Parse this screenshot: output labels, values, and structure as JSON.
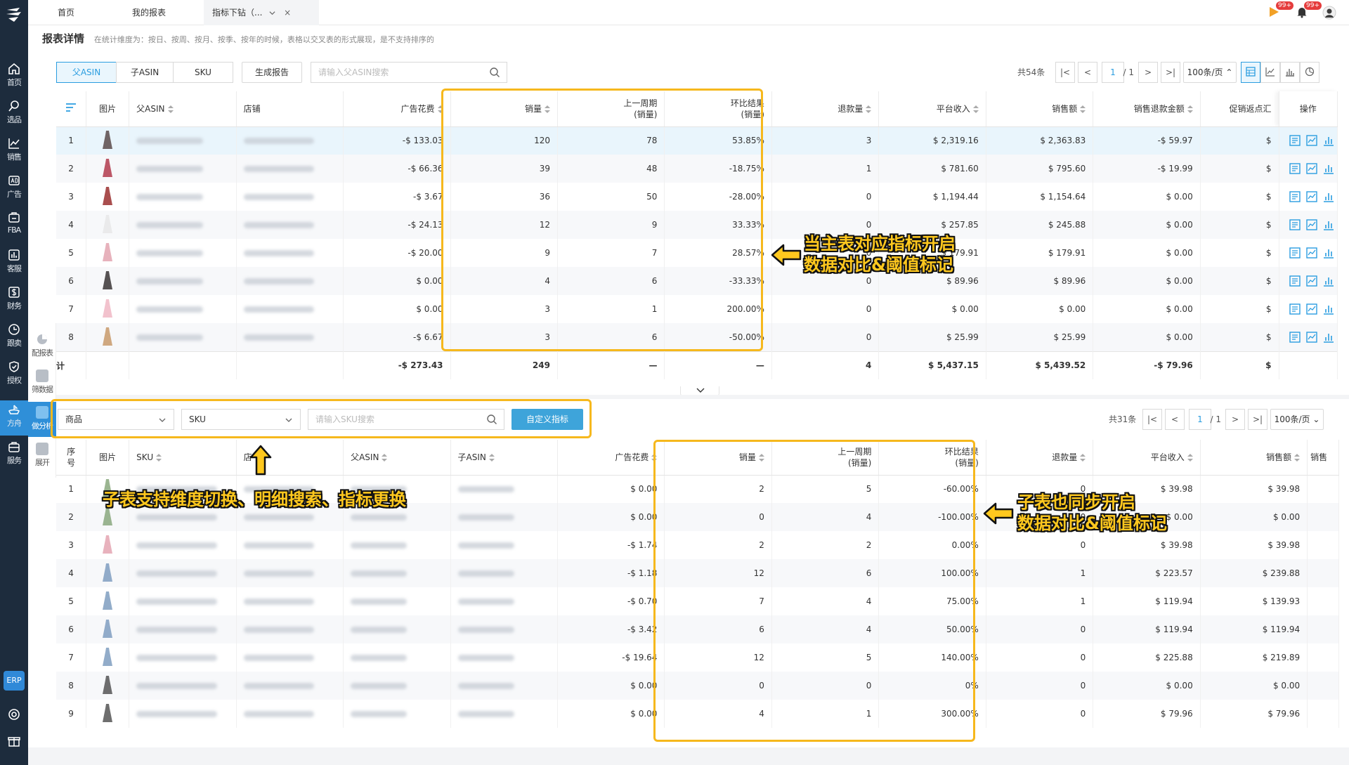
{
  "sidebar": {
    "items": [
      {
        "label": "首页",
        "icon": "home-icon"
      },
      {
        "label": "选品",
        "icon": "search-icon"
      },
      {
        "label": "销售",
        "icon": "trend-icon"
      },
      {
        "label": "广告",
        "icon": "ad-icon"
      },
      {
        "label": "FBA",
        "icon": "box-icon"
      },
      {
        "label": "客服",
        "icon": "chart-box-icon"
      },
      {
        "label": "财务",
        "icon": "dollar-icon"
      },
      {
        "label": "跟卖",
        "icon": "clock-icon"
      },
      {
        "label": "授权",
        "icon": "shield-icon"
      },
      {
        "label": "方舟",
        "icon": "ark-icon"
      },
      {
        "label": "服务",
        "icon": "briefcase-icon"
      }
    ],
    "erp": "ERP",
    "subnav": [
      {
        "label": "配报表"
      },
      {
        "label": "筛数据"
      },
      {
        "label": "做分析"
      },
      {
        "label": "展开"
      }
    ]
  },
  "tabs": [
    {
      "label": "首页"
    },
    {
      "label": "我的报表"
    },
    {
      "label": "指标下钻（...",
      "close": "×"
    }
  ],
  "badges": [
    "99+",
    "99+"
  ],
  "page": {
    "title": "报表详情",
    "desc": "在统计维度为：按日、按周、按月、按季、按年的时候，表格以交叉表的形式展现，是不支持排序的"
  },
  "main": {
    "segments": [
      "父ASIN",
      "子ASIN",
      "SKU"
    ],
    "report_button": "生成报告",
    "search_placeholder": "请输入父ASIN搜索",
    "pager": {
      "total": "共54条",
      "page": "1",
      "pages": "/ 1",
      "size": "100条/页"
    },
    "columns": [
      "图片",
      "父ASIN",
      "店铺",
      "广告花费",
      "销量",
      "上一周期",
      "(销量)",
      "环比结果",
      "(销量)",
      "退款量",
      "平台收入",
      "销售额",
      "销售退款金额",
      "促销返点汇",
      "操作"
    ],
    "rows": [
      {
        "no": "1",
        "ad": "-$ 133.03",
        "sales": "120",
        "prev": "78",
        "ratio": "53.85%",
        "refund": "3",
        "income": "$ 2,319.16",
        "amount": "$ 2,363.83",
        "refund_amt": "-$ 59.97",
        "promo": "$"
      },
      {
        "no": "2",
        "ad": "-$ 66.36",
        "sales": "39",
        "prev": "48",
        "ratio": "-18.75%",
        "refund": "1",
        "income": "$ 781.60",
        "amount": "$ 795.60",
        "refund_amt": "-$ 19.99",
        "promo": "$"
      },
      {
        "no": "3",
        "ad": "-$ 3.67",
        "sales": "36",
        "prev": "50",
        "ratio": "-28.00%",
        "refund": "0",
        "income": "$ 1,194.44",
        "amount": "$ 1,154.64",
        "refund_amt": "$ 0.00",
        "promo": "$"
      },
      {
        "no": "4",
        "ad": "-$ 24.13",
        "sales": "12",
        "prev": "9",
        "ratio": "33.33%",
        "refund": "0",
        "income": "$ 257.85",
        "amount": "$ 245.88",
        "refund_amt": "$ 0.00",
        "promo": "$"
      },
      {
        "no": "5",
        "ad": "-$ 20.00",
        "sales": "9",
        "prev": "7",
        "ratio": "28.57%",
        "refund": "0",
        "income": "$ 179.91",
        "amount": "$ 179.91",
        "refund_amt": "$ 0.00",
        "promo": "$"
      },
      {
        "no": "6",
        "ad": "$ 0.00",
        "sales": "4",
        "prev": "6",
        "ratio": "-33.33%",
        "refund": "0",
        "income": "$ 89.96",
        "amount": "$ 89.96",
        "refund_amt": "$ 0.00",
        "promo": "$"
      },
      {
        "no": "7",
        "ad": "$ 0.00",
        "sales": "3",
        "prev": "1",
        "ratio": "200.00%",
        "refund": "0",
        "income": "$ 0.00",
        "amount": "$ 0.00",
        "refund_amt": "$ 0.00",
        "promo": "$"
      },
      {
        "no": "8",
        "ad": "-$ 6.67",
        "sales": "3",
        "prev": "6",
        "ratio": "-50.00%",
        "refund": "0",
        "income": "$ 25.99",
        "amount": "$ 25.99",
        "refund_amt": "$ 0.00",
        "promo": "$"
      }
    ],
    "summary": {
      "label": "计",
      "ad": "-$ 273.43",
      "sales": "249",
      "prev": "—",
      "ratio": "—",
      "refund": "4",
      "income": "$ 5,437.15",
      "amount": "$ 5,439.52",
      "refund_amt": "-$ 79.96",
      "promo": "$"
    }
  },
  "sub": {
    "dim_select": "商品",
    "sub_select": "SKU",
    "search_placeholder": "请输入SKU搜索",
    "custom_button": "自定义指标",
    "pager": {
      "total": "共31条",
      "page": "1",
      "pages": "/ 1",
      "size": "100条/页"
    },
    "columns": [
      "序号",
      "图片",
      "SKU",
      "店",
      "父ASIN",
      "子ASIN",
      "广告花费",
      "销量",
      "上一周期",
      "(销量)",
      "环比结果",
      "(销量)",
      "退款量",
      "平台收入",
      "销售额",
      "销售"
    ],
    "rows": [
      {
        "no": "1",
        "ad": "$ 0.00",
        "sales": "2",
        "prev": "5",
        "ratio": "-60.00%",
        "refund": "0",
        "income": "$ 39.98",
        "amount": "$ 39.98"
      },
      {
        "no": "2",
        "ad": "$ 0.00",
        "sales": "0",
        "prev": "4",
        "ratio": "-100.00%",
        "refund": "0",
        "income": "$ 0.00",
        "amount": "$ 0.00"
      },
      {
        "no": "3",
        "ad": "-$ 1.74",
        "sales": "2",
        "prev": "2",
        "ratio": "0.00%",
        "refund": "0",
        "income": "$ 39.98",
        "amount": "$ 39.98"
      },
      {
        "no": "4",
        "ad": "-$ 1.18",
        "sales": "12",
        "prev": "6",
        "ratio": "100.00%",
        "refund": "1",
        "income": "$ 223.57",
        "amount": "$ 239.88"
      },
      {
        "no": "5",
        "ad": "-$ 0.70",
        "sales": "7",
        "prev": "4",
        "ratio": "75.00%",
        "refund": "1",
        "income": "$ 119.94",
        "amount": "$ 139.93"
      },
      {
        "no": "6",
        "ad": "-$ 3.42",
        "sales": "6",
        "prev": "4",
        "ratio": "50.00%",
        "refund": "0",
        "income": "$ 119.94",
        "amount": "$ 119.94"
      },
      {
        "no": "7",
        "ad": "-$ 19.64",
        "sales": "12",
        "prev": "5",
        "ratio": "140.00%",
        "refund": "0",
        "income": "$ 225.88",
        "amount": "$ 219.89"
      },
      {
        "no": "8",
        "ad": "$ 0.00",
        "sales": "0",
        "prev": "0",
        "ratio": "0%",
        "refund": "0",
        "income": "$ 0.00",
        "amount": "$ 0.00"
      },
      {
        "no": "9",
        "ad": "$ 0.00",
        "sales": "4",
        "prev": "1",
        "ratio": "300.00%",
        "refund": "0",
        "income": "$ 79.96",
        "amount": "$ 79.96"
      }
    ]
  },
  "callouts": {
    "main_line1": "当主表对应指标开启",
    "main_line2": "数据对比&阈值标记",
    "sub_dim": "子表支持维度切换、明细搜索、指标更换",
    "sub_line1": "子表也同步开启",
    "sub_line2": "数据对比&阈值标记"
  },
  "colors": {
    "sidebar": "#1d2c3d",
    "accent": "#2a9de0",
    "highlight": "#f6b81d",
    "threshold": "#f39c12",
    "callout_text": "#ffc81e"
  }
}
